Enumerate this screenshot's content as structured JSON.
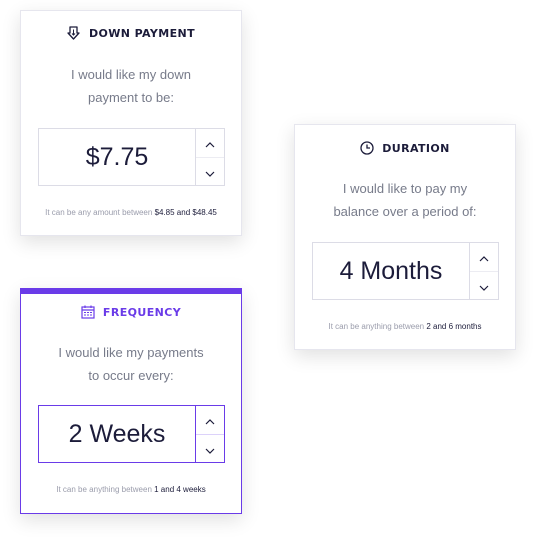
{
  "down_payment": {
    "title": "DOWN PAYMENT",
    "icon": "download-icon",
    "desc_line1": "I would like my down",
    "desc_line2": "payment to be:",
    "value": "$7.75",
    "hint_prefix": "It can be any amount between",
    "hint_range": "$4.85 and $48.45"
  },
  "duration": {
    "title": "DURATION",
    "icon": "clock-icon",
    "desc_line1": "I would like to pay my",
    "desc_line2": "balance over a period of:",
    "value": "4 Months",
    "hint_prefix": "It can be anything between",
    "hint_range": "2 and 6 months"
  },
  "frequency": {
    "title": "FREQUENCY",
    "icon": "calendar-icon",
    "desc_line1": "I would like my payments",
    "desc_line2": "to occur every:",
    "value": "2 Weeks",
    "hint_prefix": "It can be anything between",
    "hint_range": "1 and 4 weeks"
  },
  "colors": {
    "accent": "#6a3be8",
    "text": "#1c1c3a",
    "muted": "#777b8a"
  }
}
